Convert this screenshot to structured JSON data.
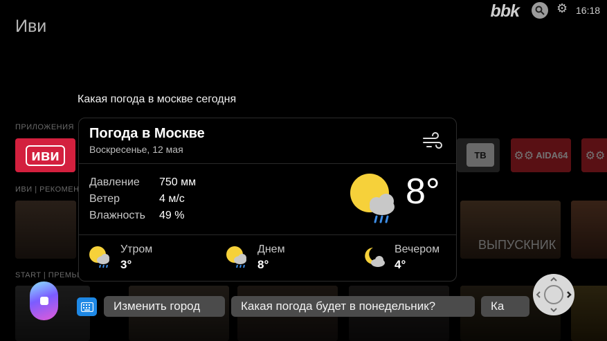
{
  "launcher": {
    "app_title": "Иви",
    "brand": "bbk",
    "clock": "16:18",
    "section_apps": "ПРИЛОЖЕНИЯ",
    "section_ivi": "ИВИ | РЕКОМЕНД",
    "section_start": "START | ПРЕМЬЕР",
    "apps": [
      {
        "label": "иви",
        "color": "#d3203e"
      },
      {
        "label": "ТВ",
        "color": "#e8e8e8"
      },
      {
        "label": "AIDA64",
        "color": "#c6242d"
      },
      {
        "label": "",
        "color": "#c6242d"
      }
    ],
    "poster_right_title": "ВЫПУСКНИК"
  },
  "assistant": {
    "query": "Какая погода в москве сегодня"
  },
  "weather": {
    "title": "Погода в Москве",
    "date": "Воскресенье, 12 мая",
    "rows": [
      {
        "label": "Давление",
        "value": "750 мм"
      },
      {
        "label": "Ветер",
        "value": "4 м/с"
      },
      {
        "label": "Влажность",
        "value": "49 %"
      }
    ],
    "temperature": "8°",
    "forecast": [
      {
        "label": "Утром",
        "temp": "3°",
        "icon": "sun-cloud-rain-icon"
      },
      {
        "label": "Днем",
        "temp": "8°",
        "icon": "sun-cloud-rain-icon"
      },
      {
        "label": "Вечером",
        "temp": "4°",
        "icon": "moon-cloud-icon"
      }
    ],
    "colors": {
      "sun": "#f6d13a",
      "cloud": "#c8c8c8",
      "rain": "#3d8de6"
    }
  },
  "suggestions": {
    "chips": [
      "Изменить город",
      "Какая погода будет в понедельник?",
      "Ка"
    ]
  }
}
